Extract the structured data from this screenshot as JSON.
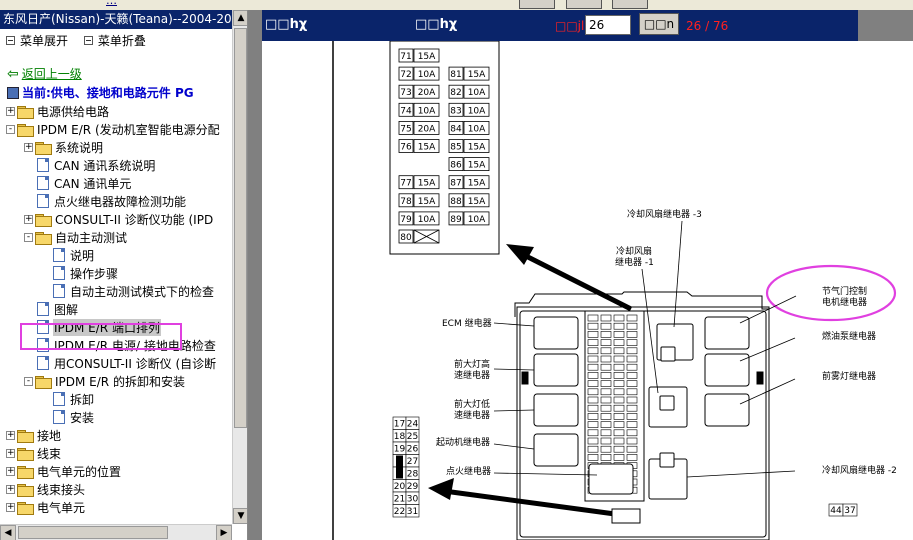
{
  "top": {
    "link_text": "…"
  },
  "tree_panel": {
    "title": "东风日产(Nissan)-天籁(Teana)--2004-20",
    "expand_label": "菜单展开",
    "collapse_label": "菜单折叠",
    "back_label": "返回上一级",
    "current_label": "当前:供电、接地和电路元件  PG",
    "items": [
      {
        "label": "电源供给电路",
        "type": "folder",
        "state": "+",
        "level": 0
      },
      {
        "label": "IPDM E/R (发动机室智能电源分配",
        "type": "folder",
        "state": "-",
        "level": 0
      },
      {
        "label": "系统说明",
        "type": "folder",
        "state": "+",
        "level": 1
      },
      {
        "label": "CAN 通讯系统说明",
        "type": "doc",
        "level": 1
      },
      {
        "label": "CAN 通讯单元",
        "type": "doc",
        "level": 1
      },
      {
        "label": "点火继电器故障检测功能",
        "type": "doc",
        "level": 1
      },
      {
        "label": "CONSULT-II 诊断仪功能 (IPD",
        "type": "folder",
        "state": "+",
        "level": 1
      },
      {
        "label": "自动主动测试",
        "type": "folder",
        "state": "-",
        "level": 1
      },
      {
        "label": "说明",
        "type": "doc",
        "level": 2
      },
      {
        "label": "操作步骤",
        "type": "doc",
        "level": 2
      },
      {
        "label": "自动主动测试模式下的检查",
        "type": "doc",
        "level": 2
      },
      {
        "label": "图解",
        "type": "doc",
        "level": 1
      },
      {
        "label": "IPDM E/R 端口排列",
        "type": "doc",
        "level": 1,
        "selected": true
      },
      {
        "label": "IPDM E/R 电源/ 接地电路检查",
        "type": "doc",
        "level": 1
      },
      {
        "label": "用CONSULT-II 诊断仪 (自诊断",
        "type": "doc",
        "level": 1
      },
      {
        "label": "IPDM E/R 的拆卸和安装",
        "type": "folder",
        "state": "-",
        "level": 1
      },
      {
        "label": "拆卸",
        "type": "doc",
        "level": 2
      },
      {
        "label": "安装",
        "type": "doc",
        "level": 2
      },
      {
        "label": "接地",
        "type": "folder",
        "state": "+",
        "level": 0
      },
      {
        "label": "线束",
        "type": "folder",
        "state": "+",
        "level": 0
      },
      {
        "label": "电气单元的位置",
        "type": "folder",
        "state": "+",
        "level": 0
      },
      {
        "label": "线束接头",
        "type": "folder",
        "state": "+",
        "level": 0
      },
      {
        "label": "电气单元",
        "type": "folder",
        "state": "+",
        "level": 0
      }
    ]
  },
  "viewer": {
    "toolbar_label_1": "□□hχ",
    "toolbar_label_2": "□□hχ",
    "page_label": "□□jl",
    "page_value": "26",
    "go_label": "□□n",
    "page_count": "26 / 76",
    "diagram": {
      "fuse_table": [
        {
          "left": [
            "71",
            "15A"
          ],
          "right": null
        },
        {
          "left": [
            "72",
            "10A"
          ],
          "right": [
            "81",
            "15A"
          ]
        },
        {
          "left": [
            "73",
            "20A"
          ],
          "right": [
            "82",
            "10A"
          ]
        },
        {
          "left": [
            "74",
            "10A"
          ],
          "right": [
            "83",
            "10A"
          ]
        },
        {
          "left": [
            "75",
            "20A"
          ],
          "right": [
            "84",
            "10A"
          ]
        },
        {
          "left": [
            "76",
            "15A"
          ],
          "right": [
            "85",
            "15A"
          ]
        },
        {
          "left": null,
          "right": [
            "86",
            "15A"
          ]
        },
        {
          "left": [
            "77",
            "15A"
          ],
          "right": [
            "87",
            "15A"
          ]
        },
        {
          "left": [
            "78",
            "15A"
          ],
          "right": [
            "88",
            "15A"
          ]
        },
        {
          "left": [
            "79",
            "10A"
          ],
          "right": [
            "89",
            "10A"
          ]
        },
        {
          "left": [
            "80",
            ""
          ],
          "right": null
        }
      ],
      "labels": {
        "cooling_fan_relay_3": "冷却风扇继电器 -3",
        "cooling_fan_relay_1_a": "冷却风扇",
        "cooling_fan_relay_1_b": "继电器 -1",
        "throttle_relay_a": "节气门控制",
        "throttle_relay_b": "电机继电器",
        "ecm_relay": "ECM 继电器",
        "fuel_pump_relay": "燃油泵继电器",
        "hi_beam_a": "前大灯高",
        "hi_beam_b": "速继电器",
        "front_fog_relay": "前雾灯继电器",
        "lo_beam_a": "前大灯低",
        "lo_beam_b": "速继电器",
        "starter_relay": "起动机继电器",
        "ignition_relay": "点火继电器",
        "cooling_fan_relay_2": "冷却风扇继电器 -2"
      },
      "connector_pins": [
        [
          "17",
          "24"
        ],
        [
          "18",
          "25"
        ],
        [
          "19",
          "26"
        ],
        [
          "",
          "27"
        ],
        [
          "",
          "28"
        ],
        [
          "20",
          "29"
        ],
        [
          "21",
          "30"
        ],
        [
          "22",
          "31"
        ]
      ],
      "connector_pins_right": [
        "44",
        "37"
      ]
    }
  }
}
